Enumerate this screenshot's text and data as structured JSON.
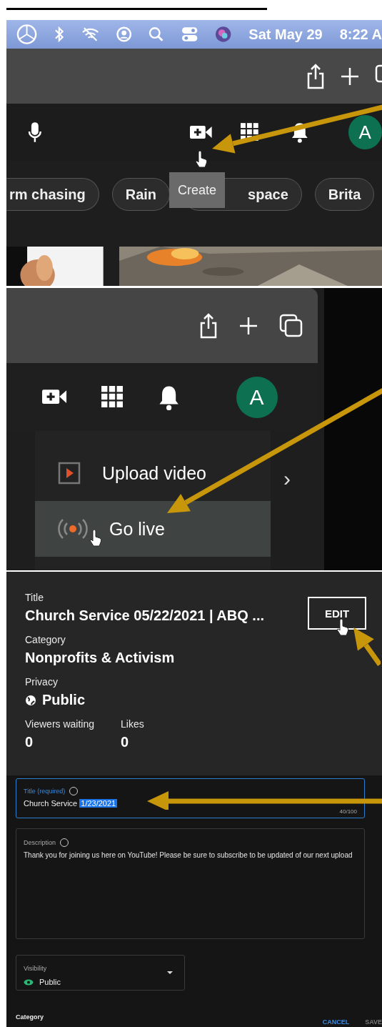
{
  "step1": {
    "menu_bar": {
      "date": "Sat May 29",
      "time": "8:22 A"
    },
    "header": {
      "avatar": "A",
      "tooltip": "Create"
    },
    "chips": [
      {
        "label": "rm chasing"
      },
      {
        "label": "Rain"
      },
      {
        "label": "space"
      },
      {
        "label": "Brita"
      }
    ]
  },
  "step2": {
    "avatar": "A",
    "menu": [
      {
        "kind": "upload",
        "label": "Upload video",
        "selected": false
      },
      {
        "kind": "live",
        "label": "Go live",
        "selected": true
      }
    ],
    "chevron": "›"
  },
  "step3": {
    "fields": [
      {
        "label": "Title",
        "value": "Church Service 05/22/2021 | ABQ ..."
      },
      {
        "label": "Category",
        "value": "Nonprofits & Activism"
      },
      {
        "label": "Privacy",
        "value": "Public"
      }
    ],
    "edit_button": "EDIT",
    "stats": [
      {
        "label": "Viewers waiting",
        "value": "0"
      },
      {
        "label": "Likes",
        "value": "0"
      }
    ]
  },
  "step4": {
    "title_field": {
      "label": "Title (required)",
      "value": "Church Service ",
      "selected_text": "1/23/2021",
      "counter": "40/100"
    },
    "description": {
      "label": "Description",
      "value": "Thank you for joining us here on YouTube! Please be sure to subscribe to be updated of our next upload"
    },
    "visibility": {
      "label": "Visibility",
      "value": "Public"
    },
    "category_heading": "Category",
    "buttons": [
      "CANCEL",
      "SAVE"
    ]
  }
}
